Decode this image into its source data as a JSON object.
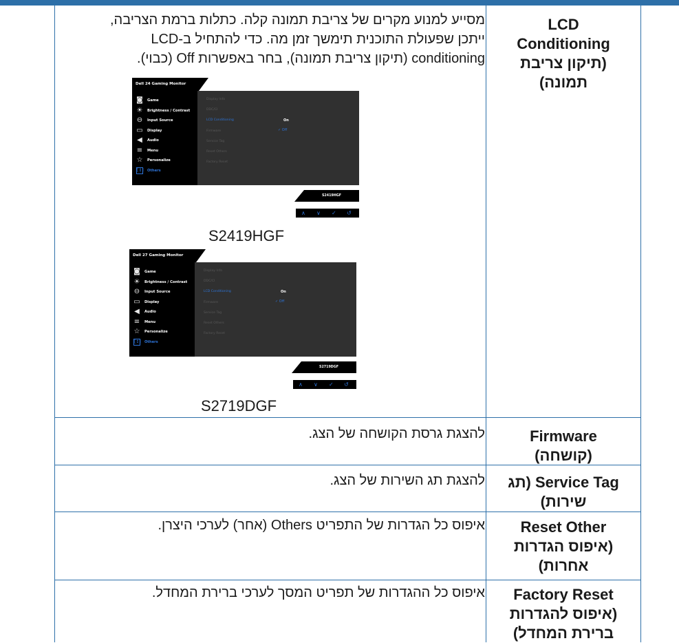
{
  "rows": [
    {
      "label_lines": [
        "LCD",
        "Conditioning",
        "(תיקון צריבת",
        "תמונה)"
      ],
      "desc_lines": [
        "מסייע למנוע מקרים של צריבת תמונה קלה. כתלות ברמת הצריבה,",
        "ייתכן שפעולת התוכנית תימשך זמן מה. כדי להתחיל ב-LCD",
        "conditioning (תיקון צריבת תמונה), בחר באפשרות Off (כבוי)."
      ]
    },
    {
      "label_lines": [
        "Firmware",
        "(קושחה)"
      ],
      "desc": "להצגת גרסת הקושחה של הצג."
    },
    {
      "label_lines": [
        "Service Tag (תג",
        "שירות)"
      ],
      "desc": "להצגת תג השירות של הצג."
    },
    {
      "label_lines": [
        "Reset Other",
        "(איפוס הגדרות",
        "אחרות)"
      ],
      "desc": "איפוס כל הגדרות של התפריט Others (אחר) לערכי היצרן."
    },
    {
      "label_lines": [
        "Factory Reset",
        "(איפוס להגדרות",
        "ברירת המחדל)"
      ],
      "desc": "איפוס כל ההגדרות של תפריט המסך לערכי ברירת המחדל."
    }
  ],
  "osd_common": {
    "menu": [
      {
        "label": "Game",
        "icon": "game-icon",
        "glyph": "◙"
      },
      {
        "label": "Brightness / Contrast",
        "icon": "brightness-icon",
        "glyph": "☀"
      },
      {
        "label": "Input Source",
        "icon": "input-source-icon",
        "glyph": "⊖"
      },
      {
        "label": "Display",
        "icon": "display-icon",
        "glyph": "▭"
      },
      {
        "label": "Audio",
        "icon": "audio-icon",
        "glyph": "◀"
      },
      {
        "label": "Menu",
        "icon": "menu-icon",
        "glyph": "≡"
      },
      {
        "label": "Personalize",
        "icon": "star-icon",
        "glyph": "☆"
      },
      {
        "label": "Others",
        "icon": "others-icon",
        "glyph": "[↕]"
      }
    ],
    "submenu": [
      "Display Info",
      "DDC/CI",
      "LCD Conditioning",
      "Firmware",
      "Service Tag",
      "Reset Others",
      "Factory Reset"
    ],
    "value_on": "On",
    "value_off": "✓ Off",
    "nav": [
      "∧",
      "∨",
      "✓",
      "↺"
    ]
  },
  "osd_24": {
    "header": "Dell 24 Gaming Monitor",
    "model": "S2419HGF",
    "caption": "S2419HGF"
  },
  "osd_27": {
    "header": "Dell 27 Gaming Monitor",
    "model": "S2719DGF",
    "caption": "S2719DGF"
  }
}
